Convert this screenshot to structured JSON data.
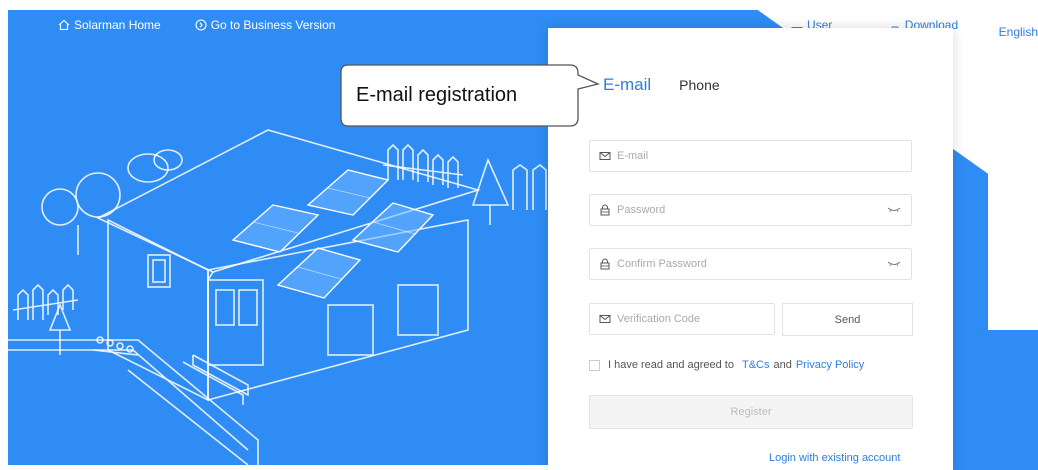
{
  "nav": {
    "home_label": "Solarman Home",
    "business_label": "Go to Business Version",
    "manual_label": "User Manual",
    "download_label": "Download APP",
    "language_label": "English"
  },
  "tabs": [
    {
      "label": "E-mail",
      "active": true
    },
    {
      "label": "Phone",
      "active": false
    }
  ],
  "form": {
    "email_placeholder": "E-mail",
    "password_placeholder": "Password",
    "confirm_placeholder": "Confirm Password",
    "code_placeholder": "Verification Code",
    "send_label": "Send",
    "agree_prefix": "I have read and agreed to",
    "tcs_label": "T&Cs",
    "and_label": "and",
    "privacy_label": "Privacy Policy",
    "register_label": "Register",
    "login_label": "Login with existing account"
  },
  "callout": {
    "text": "E-mail registration"
  },
  "colors": {
    "brand_blue": "#2f8cf5",
    "link_blue": "#2f7de0"
  }
}
